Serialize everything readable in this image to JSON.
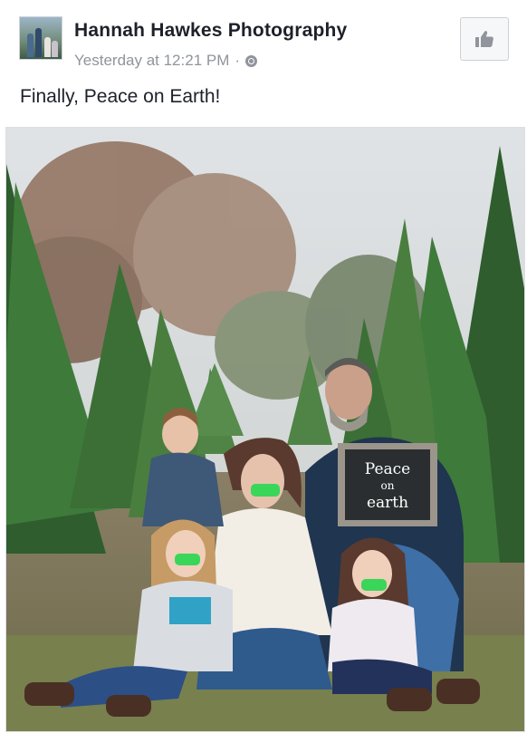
{
  "post": {
    "author": "Hannah Hawkes Photography",
    "timestamp": "Yesterday at 12:21 PM",
    "separator": "·",
    "privacy_icon": "globe-icon",
    "like_icon": "thumbs-up-icon",
    "caption": "Finally, Peace on Earth!"
  },
  "photo": {
    "sign_lines": [
      "Peace",
      "on",
      "earth"
    ]
  },
  "colors": {
    "author_text": "#1d2129",
    "meta_text": "#90949c",
    "tape_green": "#39d65a"
  }
}
